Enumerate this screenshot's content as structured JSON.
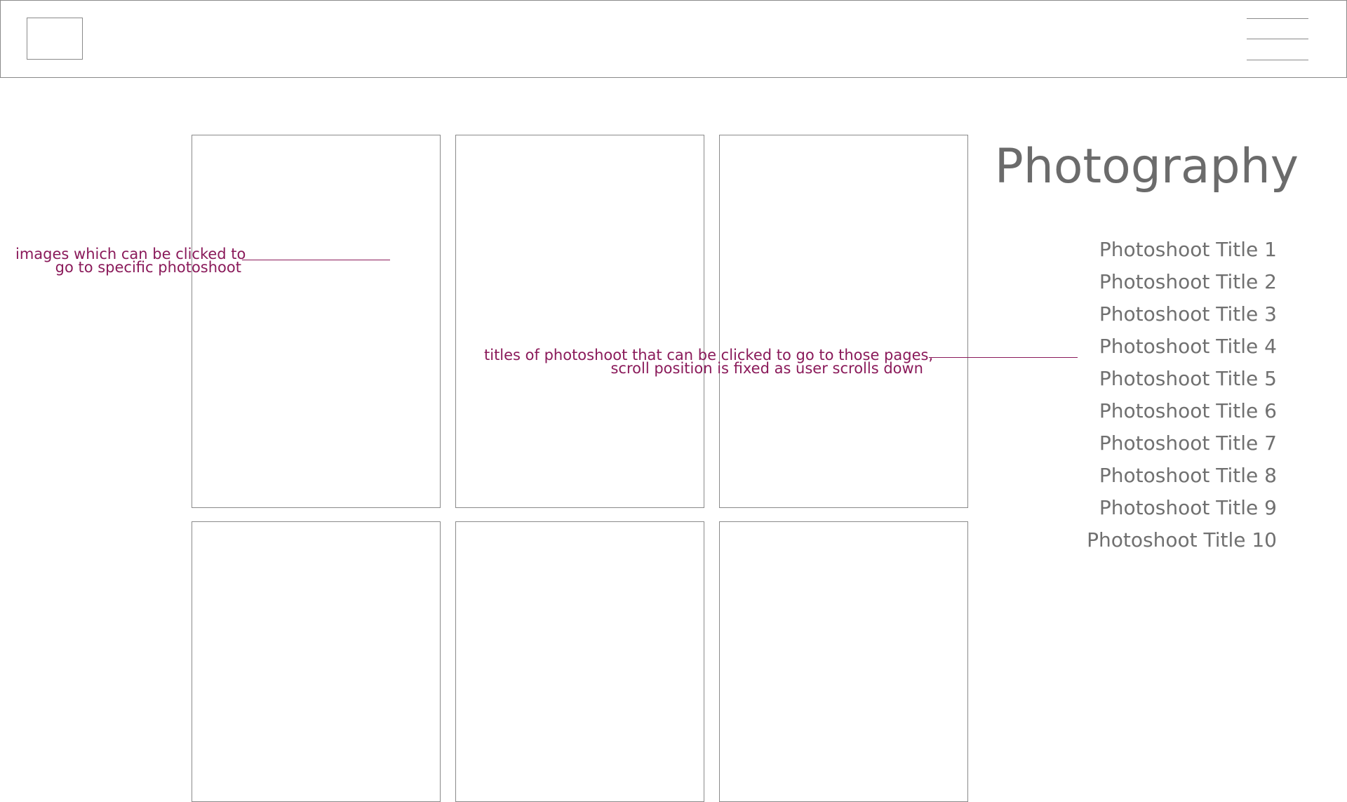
{
  "header": {
    "logo_icon": "logo-placeholder",
    "menu_icon": "hamburger-menu-icon"
  },
  "gallery": {
    "tiles": [
      {
        "label": "photoshoot-image-1"
      },
      {
        "label": "photoshoot-image-2"
      },
      {
        "label": "photoshoot-image-3"
      },
      {
        "label": "photoshoot-image-4"
      },
      {
        "label": "photoshoot-image-5"
      },
      {
        "label": "photoshoot-image-6"
      }
    ]
  },
  "sidebar": {
    "title": "Photography",
    "items": [
      "Photoshoot Title  1",
      "Photoshoot Title 2",
      "Photoshoot Title 3",
      "Photoshoot Title 4",
      "Photoshoot Title 5",
      "Photoshoot Title 6",
      "Photoshoot Title 7",
      "Photoshoot Title 8",
      "Photoshoot Title 9",
      "Photoshoot Title 10"
    ]
  },
  "annotations": {
    "images": {
      "line1": "images which can be clicked to",
      "line2": "go to specific photoshoot"
    },
    "titles": {
      "line1": "titles of photoshoot that can be clicked to go to those pages,",
      "line2": "scroll position is fixed as user scrolls down"
    }
  },
  "colors": {
    "wireframe_stroke": "#8a8a8a",
    "annotation": "#8a1a5a",
    "text_gray": "#707070"
  }
}
